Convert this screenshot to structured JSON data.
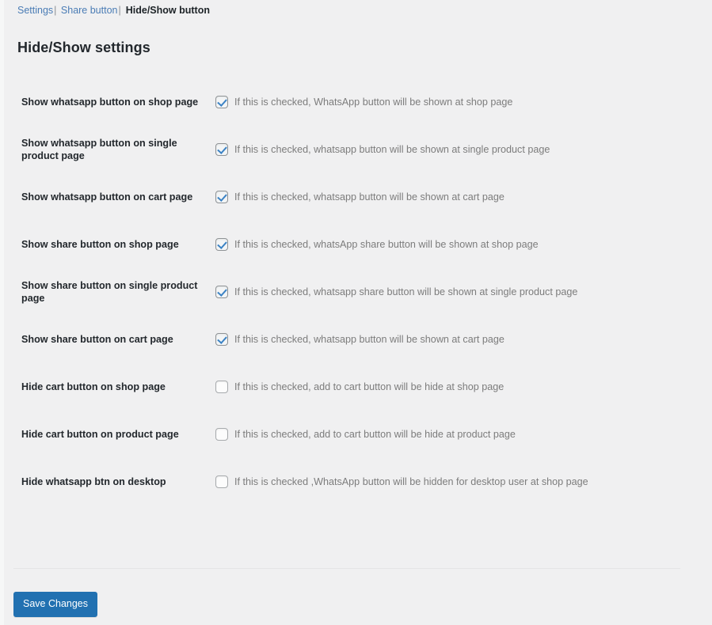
{
  "subnav": {
    "links": [
      {
        "label": "Settings",
        "separator": "|"
      },
      {
        "label": "Share button",
        "separator": "|"
      }
    ],
    "current": "Hide/Show button"
  },
  "page_title": "Hide/Show settings",
  "settings": {
    "rows": [
      {
        "label": "Show whatsapp button on shop page",
        "description": "If this is checked, WhatsApp button will be shown at shop page",
        "checked": true
      },
      {
        "label": "Show whatsapp button on single product page",
        "description": "If this is checked, whatsapp button will be shown at single product page",
        "checked": true
      },
      {
        "label": "Show whatsapp button on cart page",
        "description": "If this is checked, whatsapp button will be shown at cart page",
        "checked": true
      },
      {
        "label": "Show share button on shop page",
        "description": "If this is checked, whatsApp share button will be shown at shop page",
        "checked": true
      },
      {
        "label": "Show share button on single product page",
        "description": "If this is checked, whatsapp share button will be shown at single product page",
        "checked": true
      },
      {
        "label": "Show share button on cart page",
        "description": "If this is checked, whatsapp button will be shown at cart page",
        "checked": true
      },
      {
        "label": "Hide cart button on shop page",
        "description": "If this is checked, add to cart button will be hide at shop page",
        "checked": false
      },
      {
        "label": "Hide cart button on product page",
        "description": "If this is checked, add to cart button will be hide at product page",
        "checked": false
      },
      {
        "label": "Hide whatsapp btn on desktop",
        "description": "If this is checked ,WhatsApp button will be hidden for desktop user at shop page",
        "checked": false
      }
    ]
  },
  "submit": {
    "save_label": "Save Changes"
  },
  "colors": {
    "background": "#f0f0f1",
    "link": "#4a7cb5",
    "label_text": "#23282d",
    "description_text": "#7c7c7c",
    "primary_button": "#2271b1",
    "checkmark": "#3b82c4"
  }
}
